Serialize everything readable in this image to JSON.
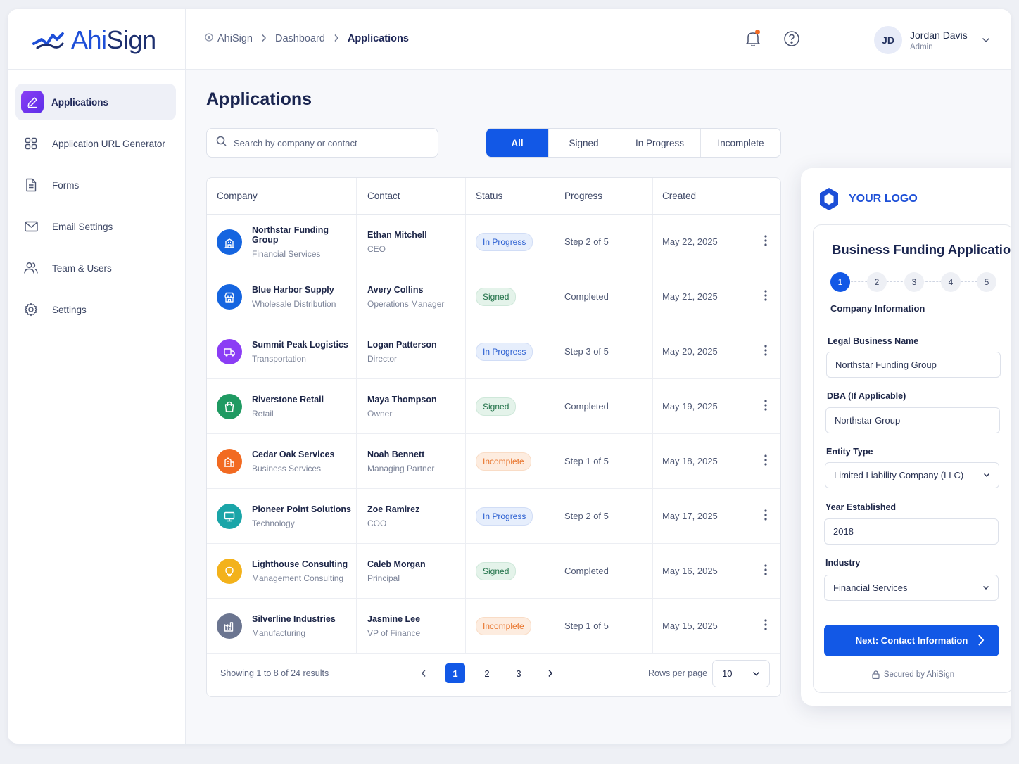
{
  "brand": {
    "name_part1": "Ahi",
    "name_part2": "Sign"
  },
  "sidebar": {
    "items": [
      {
        "label": "Applications",
        "icon": "pen-icon",
        "active": true
      },
      {
        "label": "Application URL Generator",
        "icon": "grid-icon"
      },
      {
        "label": "Forms",
        "icon": "document-icon"
      },
      {
        "label": "Email Settings",
        "icon": "mail-icon"
      },
      {
        "label": "Team & Users",
        "icon": "users-icon"
      },
      {
        "label": "Settings",
        "icon": "gear-icon"
      }
    ]
  },
  "header": {
    "breadcrumb": [
      "AhiSign",
      "Dashboard",
      "Applications"
    ],
    "user": {
      "initials": "JD",
      "name": "Jordan Davis",
      "role": "Admin"
    }
  },
  "main": {
    "title": "Applications",
    "search_placeholder": "Search by company or contact",
    "filters": [
      "All",
      "Signed",
      "In Progress",
      "Incomplete"
    ],
    "active_filter": "All",
    "columns": [
      "Company",
      "Contact",
      "Status",
      "Progress",
      "Created"
    ],
    "rows": [
      {
        "company": "Northstar Funding Group",
        "industry": "Financial Services",
        "contact": "Ethan Mitchell",
        "role": "CEO",
        "status": "In Progress",
        "progress": "Step 2 of 5",
        "created": "May 22, 2025",
        "icon": "building-icon",
        "color": "#1565e0"
      },
      {
        "company": "Blue Harbor Supply",
        "industry": "Wholesale Distribution",
        "contact": "Avery Collins",
        "role": "Operations Manager",
        "status": "Signed",
        "progress": "Completed",
        "created": "May 21, 2025",
        "icon": "store-icon",
        "color": "#1565e0"
      },
      {
        "company": "Summit Peak Logistics",
        "industry": "Transportation",
        "contact": "Logan Patterson",
        "role": "Director",
        "status": "In Progress",
        "progress": "Step 3 of 5",
        "created": "May 20, 2025",
        "icon": "truck-icon",
        "color": "#8b3df5"
      },
      {
        "company": "Riverstone Retail",
        "industry": "Retail",
        "contact": "Maya Thompson",
        "role": "Owner",
        "status": "Signed",
        "progress": "Completed",
        "created": "May 19, 2025",
        "icon": "shopping-bag-icon",
        "color": "#1f9a62"
      },
      {
        "company": "Cedar Oak Services",
        "industry": "Business Services",
        "contact": "Noah Bennett",
        "role": "Managing Partner",
        "status": "Incomplete",
        "progress": "Step 1 of 5",
        "created": "May 18, 2025",
        "icon": "buildings-icon",
        "color": "#f26a21"
      },
      {
        "company": "Pioneer Point Solutions",
        "industry": "Technology",
        "contact": "Zoe Ramirez",
        "role": "COO",
        "status": "In Progress",
        "progress": "Step 2 of 5",
        "created": "May 17, 2025",
        "icon": "monitor-icon",
        "color": "#1aa5a8"
      },
      {
        "company": "Lighthouse Consulting",
        "industry": "Management Consulting",
        "contact": "Caleb Morgan",
        "role": "Principal",
        "status": "Signed",
        "progress": "Completed",
        "created": "May 16, 2025",
        "icon": "lightbulb-icon",
        "color": "#f3b21b"
      },
      {
        "company": "Silverline Industries",
        "industry": "Manufacturing",
        "contact": "Jasmine Lee",
        "role": "VP of Finance",
        "status": "Incomplete",
        "progress": "Step 1 of 5",
        "created": "May 15, 2025",
        "icon": "factory-icon",
        "color": "#6b7590"
      }
    ],
    "footer": {
      "showing": "Showing 1 to 8 of 24 results",
      "pages": [
        "1",
        "2",
        "3"
      ],
      "current_page": "1",
      "rows_per_page_label": "Rows per page",
      "rows_per_page": "10"
    }
  },
  "form_preview": {
    "logo_text": "YOUR LOGO",
    "title": "Business Funding Application",
    "steps": [
      "1",
      "2",
      "3",
      "4",
      "5"
    ],
    "current_step": "1",
    "step_label": "Company Information",
    "fields": [
      {
        "label": "Legal Business Name",
        "value": "Northstar Funding Group",
        "type": "text"
      },
      {
        "label": "DBA (If Applicable)",
        "value": "Northstar Group",
        "type": "text"
      },
      {
        "label": "Entity Type",
        "value": "Limited Liability Company (LLC)",
        "type": "select"
      },
      {
        "label": "Year Established",
        "value": "2018",
        "type": "text"
      },
      {
        "label": "Industry",
        "value": "Financial Services",
        "type": "select"
      }
    ],
    "next_button": "Next: Contact Information",
    "secured_text": "Secured by AhiSign"
  },
  "colors": {
    "primary": "#1258e6",
    "brand_dark": "#1d2f6f",
    "accent_purple": "#7b3af2"
  }
}
